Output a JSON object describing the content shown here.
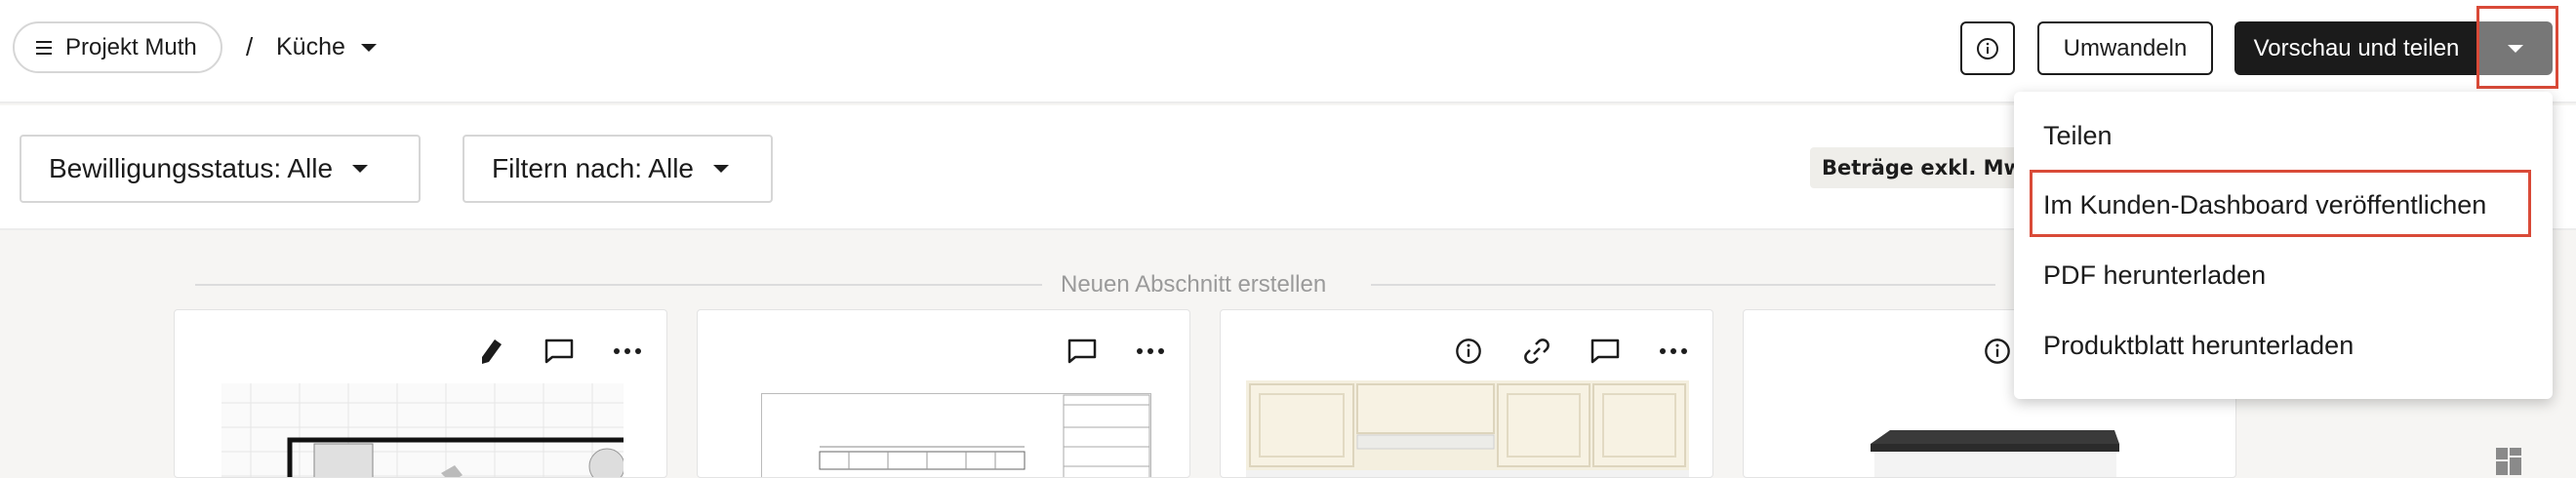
{
  "header": {
    "project_label": "Projekt Muth",
    "breadcrumb_separator": "/",
    "room_label": "Küche",
    "convert_label": "Umwandeln",
    "preview_share_label": "Vorschau und teilen"
  },
  "filters": {
    "approval_status_label": "Bewilligungsstatus: Alle",
    "filter_by_label": "Filtern nach: Alle",
    "amount_badge": "Beträge exkl. MwSt."
  },
  "main": {
    "new_section_label": "Neuen Abschnitt erstellen"
  },
  "dropdown": {
    "items": [
      {
        "label": "Teilen"
      },
      {
        "label": "Im Kunden-Dashboard veröffentlichen"
      },
      {
        "label": "PDF herunterladen"
      },
      {
        "label": "Produktblatt herunterladen"
      }
    ]
  },
  "colors": {
    "primary_dark": "#1b1b1b",
    "split_button": "#777777",
    "highlight": "#d94a38",
    "background": "#f6f5f3"
  }
}
